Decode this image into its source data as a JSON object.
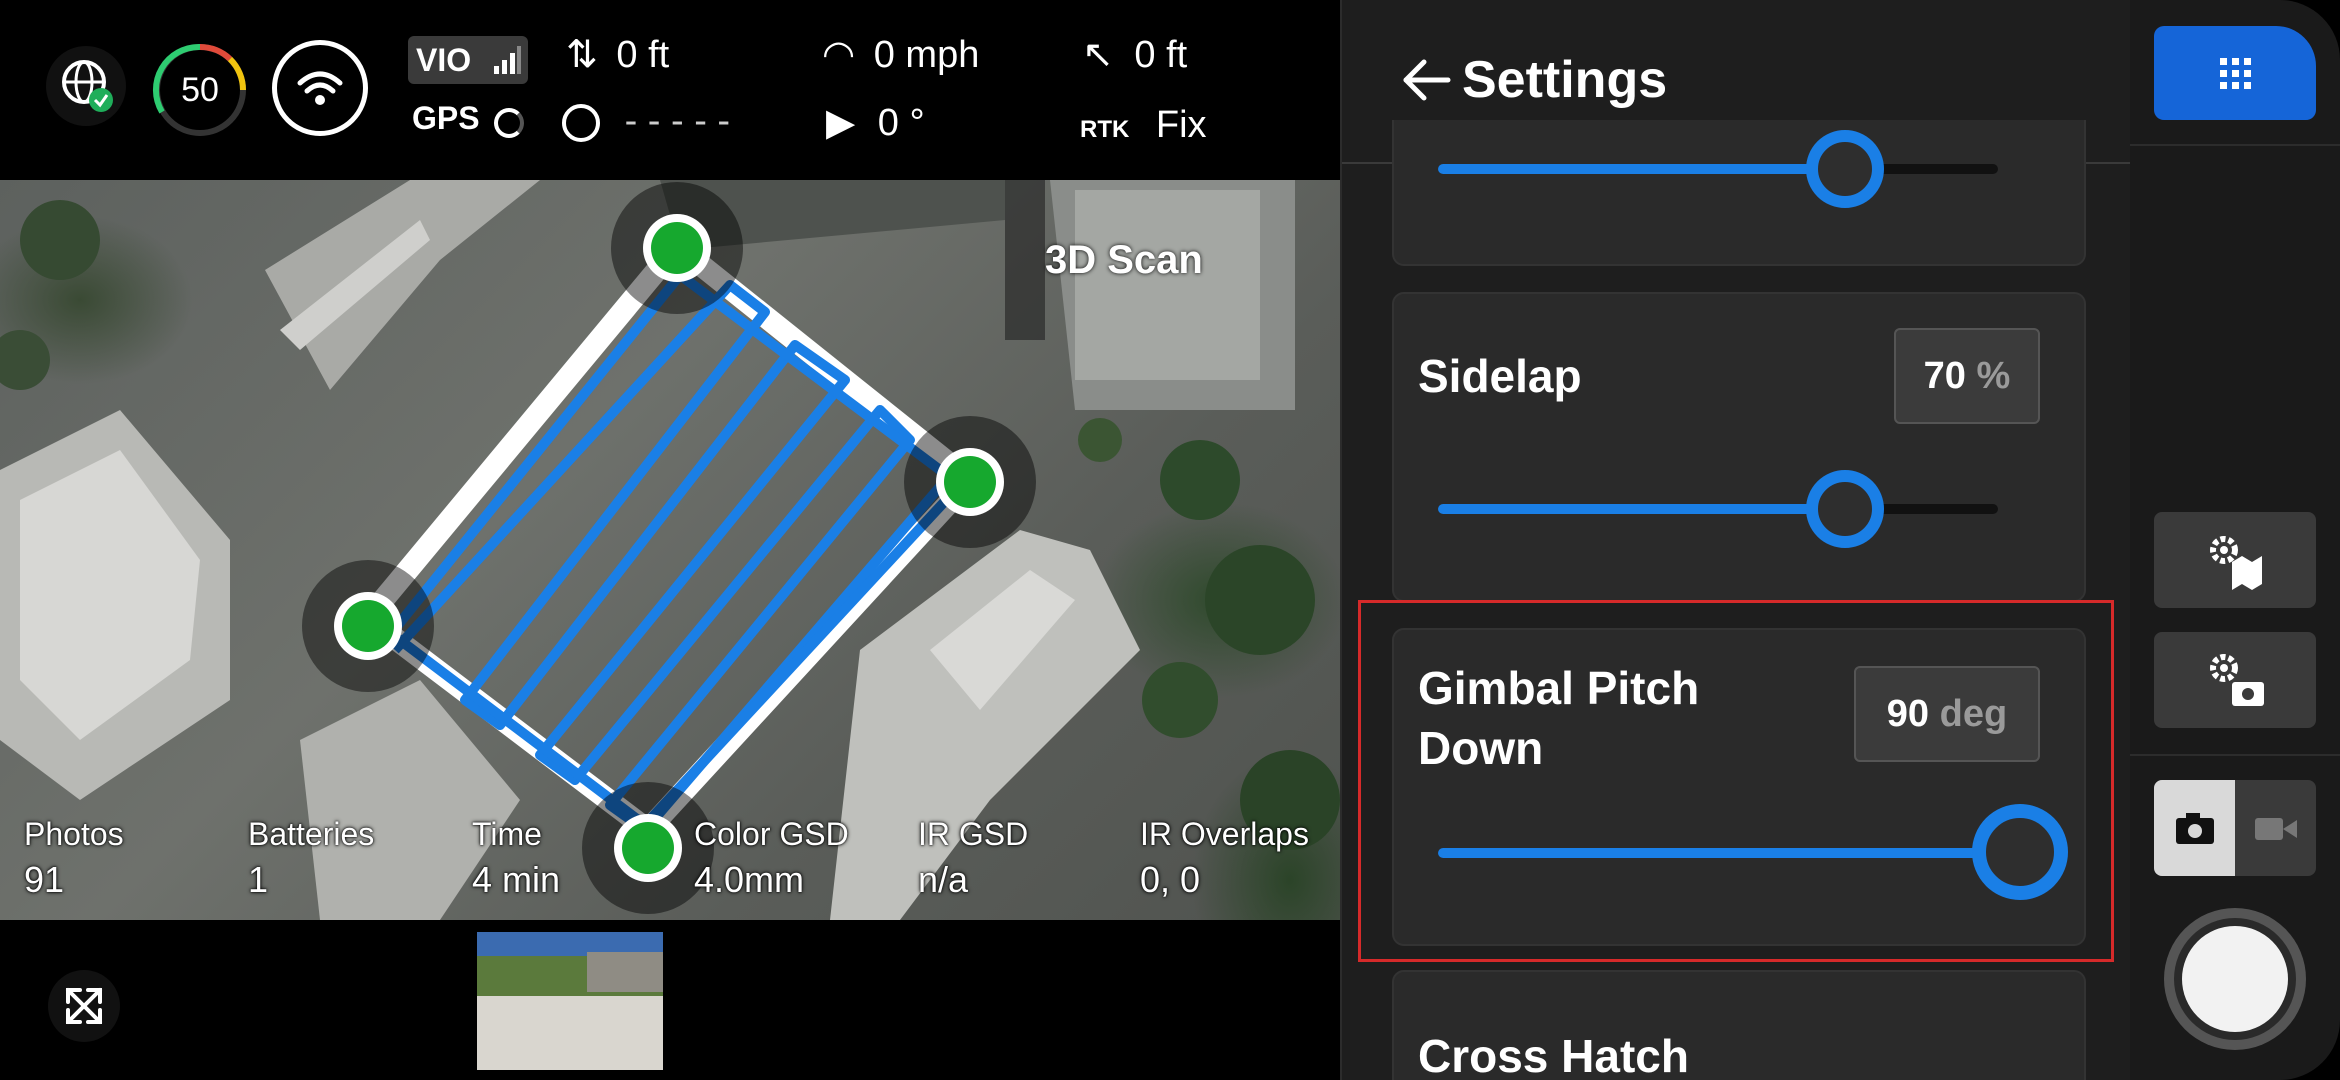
{
  "status": {
    "signal_value": "50",
    "vio_label": "VIO",
    "gps_label": "GPS",
    "vertical_distance": "0 ft",
    "heading": "- - - - -",
    "speed": "0 mph",
    "camera_angle": "0 °",
    "home_distance": "0 ft",
    "rtk_label": "RTK",
    "rtk_status": "Fix"
  },
  "map": {
    "overlay_label": "3D Scan"
  },
  "stats": [
    {
      "label": "Photos",
      "value": "91"
    },
    {
      "label": "Batteries",
      "value": "1"
    },
    {
      "label": "Time",
      "value": "4 min"
    },
    {
      "label": "Color GSD",
      "value": "4.0mm"
    },
    {
      "label": "IR GSD",
      "value": "n/a"
    },
    {
      "label": "IR Overlaps",
      "value": "0, 0"
    }
  ],
  "settings": {
    "title": "Settings",
    "sidelap": {
      "label": "Sidelap",
      "value": "70",
      "unit": "%",
      "level": 0.72
    },
    "gimbal": {
      "label_line1": "Gimbal Pitch",
      "label_line2": "Down",
      "value": "90",
      "unit": "deg",
      "level": 1.0
    },
    "cross_hatch": {
      "label": "Cross Hatch"
    },
    "top_slider_level": 0.72
  },
  "icons": {
    "globe": "globe-check-icon",
    "wifi": "wifi-icon",
    "apps": "grid-menu-icon",
    "map_settings": "map-settings-icon",
    "camera_settings": "camera-settings-icon",
    "photo_mode": "camera-icon",
    "video_mode": "video-icon",
    "shutter": "shutter-button",
    "expand": "expand-icon"
  },
  "colors": {
    "accent": "#1a7fe6",
    "waypoint": "#16a82e",
    "highlight_border": "#d62a2a"
  }
}
